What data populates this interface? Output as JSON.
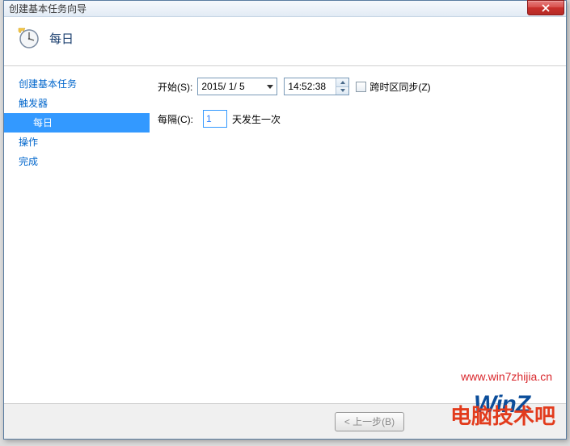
{
  "window": {
    "title": "创建基本任务向导"
  },
  "header": {
    "title": "每日"
  },
  "sidebar": {
    "items": [
      {
        "label": "创建基本任务",
        "indent": false,
        "selected": false
      },
      {
        "label": "触发器",
        "indent": false,
        "selected": false
      },
      {
        "label": "每日",
        "indent": true,
        "selected": true
      },
      {
        "label": "操作",
        "indent": false,
        "selected": false
      },
      {
        "label": "完成",
        "indent": false,
        "selected": false
      }
    ]
  },
  "form": {
    "start_label": "开始(S):",
    "date_value": "2015/ 1/ 5",
    "time_value": "14:52:38",
    "sync_label": "跨时区同步(Z)",
    "interval_label": "每隔(C):",
    "interval_value": "1",
    "interval_suffix": "天发生一次"
  },
  "footer": {
    "back": "< 上一步(B)"
  },
  "watermark": {
    "url": "www.win7zhijia.cn",
    "logo": "WinZ",
    "brand": "电脑技术吧"
  }
}
